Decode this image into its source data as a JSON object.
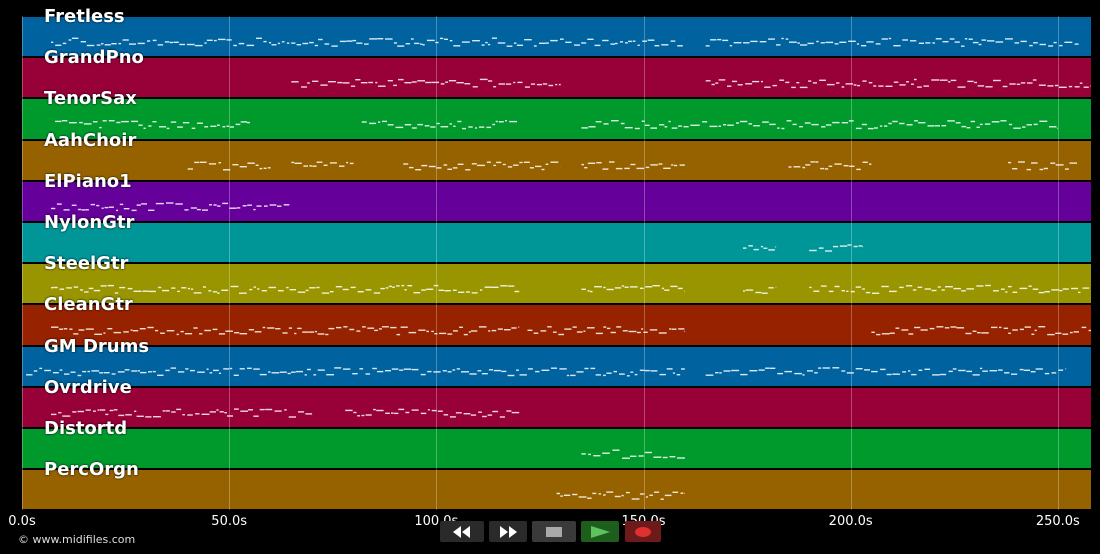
{
  "tracks": [
    {
      "name": "Fretless",
      "color": "#0063a0"
    },
    {
      "name": "GrandPno",
      "color": "#980038"
    },
    {
      "name": "TenorSax",
      "color": "#009a2c"
    },
    {
      "name": "AahChoir",
      "color": "#966200"
    },
    {
      "name": "ElPiano1",
      "color": "#65009a"
    },
    {
      "name": "NylonGtr",
      "color": "#009698"
    },
    {
      "name": "SteelGtr",
      "color": "#999500"
    },
    {
      "name": "CleanGtr",
      "color": "#962200"
    },
    {
      "name": "GM Drums",
      "color": "#0063a0"
    },
    {
      "name": "Ovrdrive",
      "color": "#980038"
    },
    {
      "name": "Distortd",
      "color": "#009a2c"
    },
    {
      "name": "PercOrgn",
      "color": "#966200"
    }
  ],
  "timeline": {
    "ticks": [
      "0.0s",
      "50.0s",
      "100.0s",
      "150.0s",
      "200.0s",
      "250.0s"
    ]
  },
  "footer": {
    "copyright": "© www.midifiles.com"
  },
  "transport": {
    "rewind_icon": "rewind-icon",
    "fast_forward_icon": "fast-forward-icon",
    "stop_icon": "stop-icon",
    "play_icon": "play-icon",
    "record_icon": "record-icon"
  },
  "note_segments": [
    [
      [
        7,
        160
      ],
      [
        165,
        255
      ]
    ],
    [
      [
        65,
        130
      ],
      [
        165,
        258
      ]
    ],
    [
      [
        8,
        55
      ],
      [
        82,
        120
      ],
      [
        135,
        250
      ]
    ],
    [
      [
        40,
        60
      ],
      [
        65,
        80
      ],
      [
        92,
        130
      ],
      [
        135,
        160
      ],
      [
        185,
        205
      ],
      [
        238,
        255
      ]
    ],
    [
      [
        7,
        65
      ]
    ],
    [
      [
        174,
        182
      ],
      [
        190,
        203
      ]
    ],
    [
      [
        7,
        120
      ],
      [
        135,
        160
      ],
      [
        174,
        182
      ],
      [
        190,
        258
      ]
    ],
    [
      [
        7,
        120
      ],
      [
        122,
        160
      ],
      [
        205,
        258
      ]
    ],
    [
      [
        1,
        160
      ],
      [
        165,
        252
      ]
    ],
    [
      [
        7,
        70
      ],
      [
        78,
        120
      ]
    ],
    [
      [
        135,
        160
      ]
    ],
    [
      [
        129,
        160
      ]
    ]
  ]
}
